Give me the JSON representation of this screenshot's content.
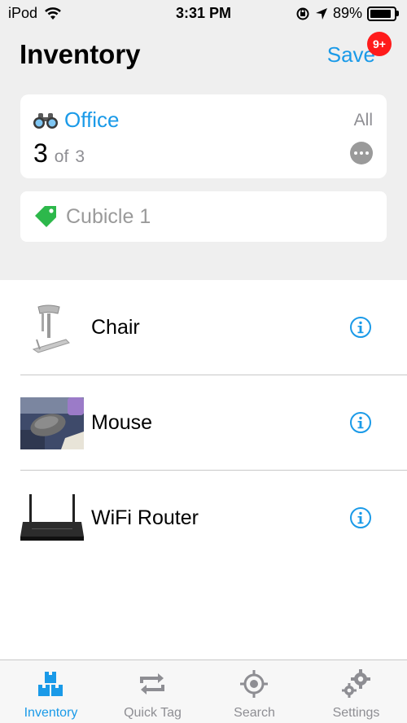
{
  "status_bar": {
    "carrier": "iPod",
    "time": "3:31 PM",
    "battery_percent": "89%",
    "battery_level": 0.89
  },
  "header": {
    "title": "Inventory",
    "save_label": "Save",
    "badge_count": "9+"
  },
  "location": {
    "name": "Office",
    "all_label": "All",
    "count": "3",
    "of_label": "of",
    "total": "3"
  },
  "tag": {
    "name": "Cubicle 1"
  },
  "items": [
    {
      "name": "Chair",
      "thumb_icon": "chair-photo"
    },
    {
      "name": "Mouse",
      "thumb_icon": "mouse-photo"
    },
    {
      "name": "WiFi Router",
      "thumb_icon": "router-photo"
    }
  ],
  "tabs": [
    {
      "label": "Inventory",
      "icon": "boxes-icon",
      "active": true
    },
    {
      "label": "Quick Tag",
      "icon": "repeat-icon",
      "active": false
    },
    {
      "label": "Search",
      "icon": "target-icon",
      "active": false
    },
    {
      "label": "Settings",
      "icon": "gears-icon",
      "active": false
    }
  ],
  "colors": {
    "accent": "#1a9ae8",
    "badge": "#ff1b1b",
    "tag_green": "#2db84b",
    "muted": "#8e8e93",
    "background": "#efefef"
  }
}
